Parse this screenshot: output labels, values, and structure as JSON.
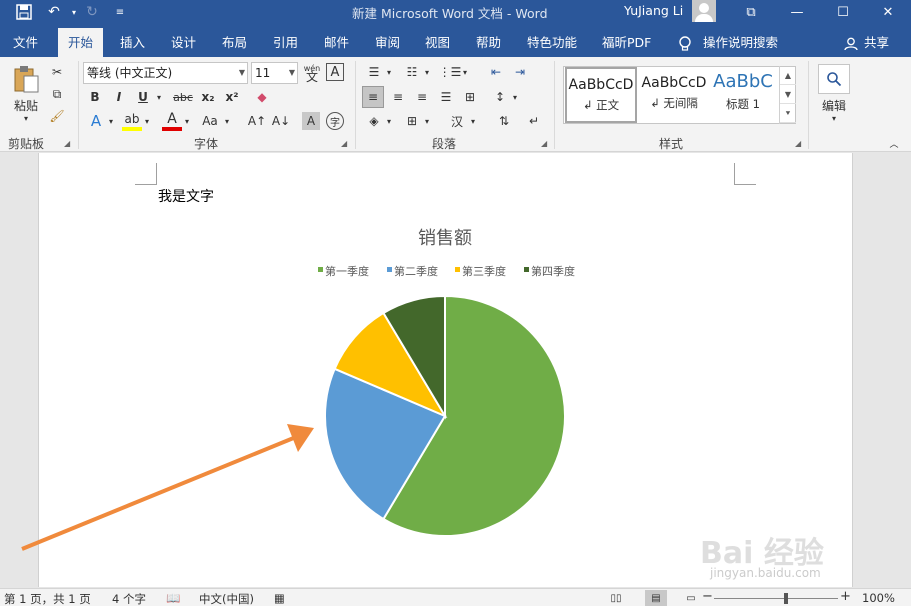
{
  "titlebar": {
    "title": "新建 Microsoft Word 文档 - Word",
    "user": "YuJiang Li"
  },
  "tabs": [
    "文件",
    "开始",
    "插入",
    "设计",
    "布局",
    "引用",
    "邮件",
    "审阅",
    "视图",
    "帮助",
    "特色功能",
    "福昕PDF",
    "操作说明搜索",
    "共享"
  ],
  "ribbon": {
    "clipboard": {
      "paste_label": "粘贴",
      "group_label": "剪贴板"
    },
    "font": {
      "font_name": "等线 (中文正文)",
      "font_size": "11",
      "wen_glyph": "wén",
      "group_label": "字体",
      "buttons": [
        "B",
        "I",
        "U",
        "abc",
        "x₂",
        "x²",
        "A",
        "A",
        "Aa",
        "A↑",
        "A↓",
        "A",
        "字"
      ]
    },
    "paragraph": {
      "group_label": "段落"
    },
    "styles": {
      "group_label": "样式",
      "items": [
        {
          "sample": "AaBbCcD",
          "name": "↲ 正文"
        },
        {
          "sample": "AaBbCcD",
          "name": "↲ 无间隔"
        },
        {
          "sample": "AaBbC",
          "name": "标题 1"
        }
      ]
    },
    "editing": {
      "label": "编辑"
    }
  },
  "document": {
    "text": "我是文字"
  },
  "chart_data": {
    "type": "pie",
    "title": "销售额",
    "categories": [
      "第一季度",
      "第二季度",
      "第三季度",
      "第四季度"
    ],
    "values": [
      8.2,
      3.2,
      1.4,
      1.2
    ],
    "colors": [
      "#70ad47",
      "#5b9bd5",
      "#ffc000",
      "#43682b"
    ],
    "legend_position": "top"
  },
  "annotation": {
    "arrow_color": "#f08a3c"
  },
  "status": {
    "page": "第 1 页，共 1 页",
    "words": "4 个字",
    "language": "中文(中国)",
    "zoom": "100%"
  },
  "watermark": {
    "main": "Bai 经验",
    "sub": "jingyan.baidu.com"
  }
}
